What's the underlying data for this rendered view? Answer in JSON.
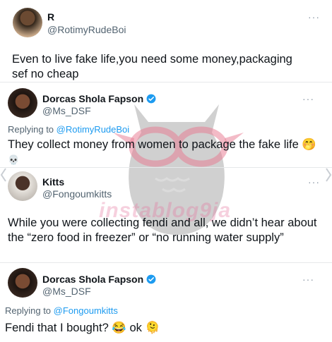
{
  "tweets": [
    {
      "name": "R",
      "handle": "@RotimyRudeBoi",
      "more": "···",
      "text": "Even to live fake life,you need some money,packaging sef no cheap"
    },
    {
      "name": "Dorcas Shola Fapson",
      "handle": "@Ms_DSF",
      "more": "···",
      "reply_prefix": "Replying to ",
      "reply_mention": "@RotimyRudeBoi",
      "text": "They collect money from women to package the fake life 🤭",
      "text_line2": "💀"
    },
    {
      "name": "Kitts",
      "handle": "@Fongoumkitts",
      "more": "···",
      "text": "While you were collecting fendi and all, we didn’t hear about the “zero food in freezer” or “no running water supply”"
    },
    {
      "name": "Dorcas Shola Fapson",
      "handle": "@Ms_DSF",
      "more": "···",
      "reply_prefix": "Replying to ",
      "reply_mention": "@Fongoumkitts",
      "text": "Fendi that I bought? 😂 ok 🫠"
    }
  ],
  "watermark_text": "instablog9ja",
  "colors": {
    "link": "#1d9bf0",
    "verified": "#1d9bf0",
    "secondary_text": "#536471"
  }
}
